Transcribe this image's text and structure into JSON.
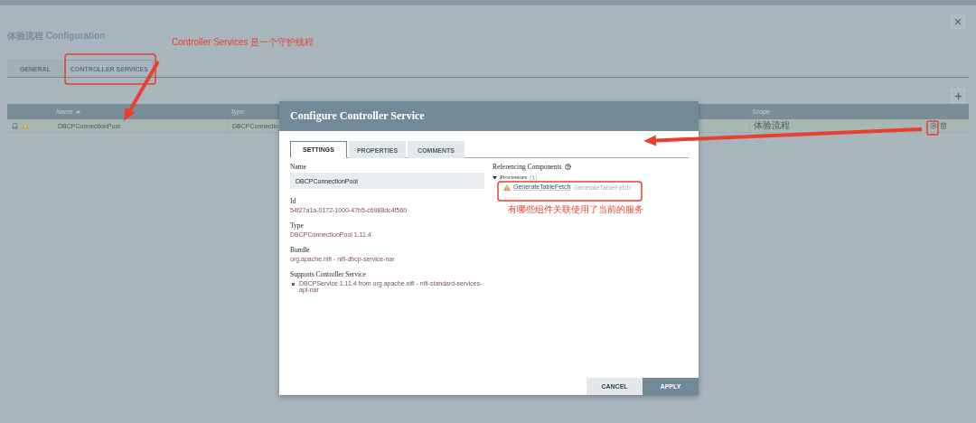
{
  "dialog": {
    "title": "体验流程 Configuration",
    "tabs": [
      {
        "label": "GENERAL",
        "selected": false
      },
      {
        "label": "CONTROLLER SERVICES",
        "selected": true
      }
    ],
    "table": {
      "columns": [
        {
          "label": "Name",
          "sorted": true
        },
        {
          "label": "Type",
          "sorted": false
        },
        {
          "label": "Scope",
          "sorted": false
        }
      ],
      "rows": [
        {
          "name": "DBCPConnectionPool",
          "type": "DBCPConnectio",
          "scope": "体验流程",
          "warning": true
        }
      ]
    }
  },
  "modal": {
    "title": "Configure Controller Service",
    "tabs": [
      {
        "label": "SETTINGS",
        "selected": true
      },
      {
        "label": "PROPERTIES",
        "selected": false
      },
      {
        "label": "COMMENTS",
        "selected": false
      }
    ],
    "fields": [
      {
        "kind": "input",
        "label": "Name",
        "value": "DBCPConnectionPool"
      },
      {
        "kind": "text",
        "label": "Id",
        "value": "54f27a1a-0172-1000-47b5-c6988dc4f560"
      },
      {
        "kind": "text",
        "label": "Type",
        "value": "DBCPConnectionPool 1.11.4"
      },
      {
        "kind": "text",
        "label": "Bundle",
        "value": "org.apache.nifi - nifi-dbcp-service-nar"
      },
      {
        "kind": "list",
        "label": "Supports Controller Service",
        "items": [
          "DBCPService 1.11.4 from org.apache.nifi - nifi-standard-services-api-nar"
        ]
      }
    ],
    "referencing": {
      "title": "Referencing Components",
      "groups": [
        {
          "label": "Processors",
          "count": "(1)",
          "expanded": true,
          "items": [
            {
              "name": "GenerateTableFetch",
              "type": "GenerateTableFetch",
              "warning": true
            }
          ]
        }
      ]
    },
    "buttons": [
      {
        "label": "CANCEL",
        "kind": "secondary"
      },
      {
        "label": "APPLY",
        "kind": "primary"
      }
    ]
  },
  "annotations": [
    {
      "text": "Controller Services 是一个守护线程"
    },
    {
      "text": "有哪些组件关联使用了当前的服务"
    }
  ]
}
